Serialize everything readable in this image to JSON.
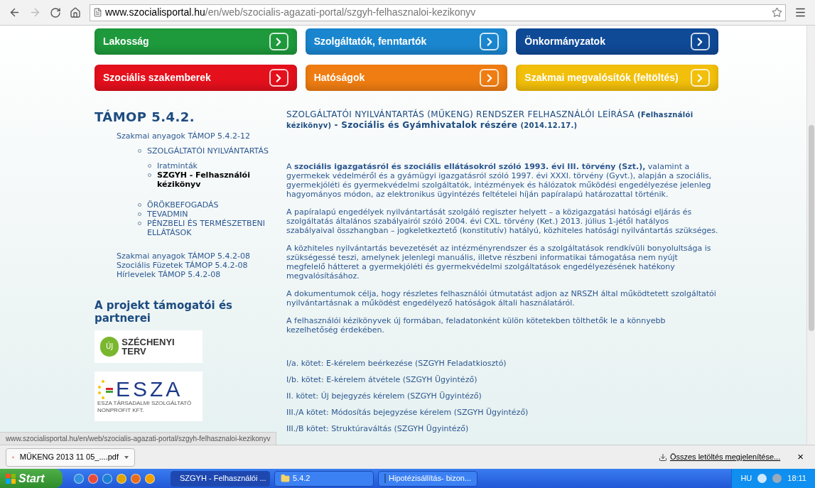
{
  "browser": {
    "url_host": "www.szocialisportal.hu",
    "url_path": "/en/web/szocialis-agazati-portal/szgyh-felhasznaloi-kezikonyv"
  },
  "categories": [
    {
      "label": "Lakosság",
      "color": "#1e9a3c"
    },
    {
      "label": "Szolgáltatók, fenntartók",
      "color": "#1a86cf"
    },
    {
      "label": "Önkormányzatok",
      "color": "#0f4a97"
    },
    {
      "label": "Szociális szakemberek",
      "color": "#e4101c"
    },
    {
      "label": "Hatóságok",
      "color": "#ef7d12"
    },
    {
      "label": "Szakmai megvalósítók (feltöltés)",
      "color": "#f2bf0a"
    }
  ],
  "sidebar": {
    "title": "TÁMOP 5.4.2.",
    "items": [
      {
        "label": "Szakmai anyagok TÁMOP 5.4.2-12",
        "selected": false,
        "children": [
          {
            "label": "SZOLGÁLTATÓI NYILVÁNTARTÁS",
            "selected": false,
            "children": [
              {
                "label": "Iratminták",
                "selected": false
              },
              {
                "label": "SZGYH - Felhasználói kézikönyv",
                "selected": true
              }
            ]
          },
          {
            "label": "ÖRÖKBEFOGADÁS",
            "selected": false
          },
          {
            "label": "TEVADMIN",
            "selected": false
          },
          {
            "label": "PÉNZBELI ÉS TERMÉSZETBENI ELLÁTÁSOK",
            "selected": false
          }
        ]
      },
      {
        "label": "Szakmai anyagok TÁMOP 5.4.2-08",
        "selected": false
      },
      {
        "label": "Szociális Füzetek TÁMOP 5.4.2-08",
        "selected": false
      },
      {
        "label": "Hírlevelek TÁMOP 5.4.2-08",
        "selected": false
      }
    ],
    "partners_title": "A projekt támogatói és partnerei",
    "partners": [
      {
        "kind": "szechenyi",
        "badge": "ÚJ",
        "name": "SZÉCHENYI TERV"
      },
      {
        "kind": "esza",
        "name": "ESZA",
        "subtitle": "ESZA TÁRSADALMI SZOLGÁLTATÓ NONPROFIT KFT."
      }
    ]
  },
  "article": {
    "title": "SZOLGÁLTATÓI NYILVÁNTARTÁS (MŰKENG) RENDSZER FELHASZNÁLÓI LEÍRÁSA",
    "title_small": "(Felhasználói kézikönyv)",
    "title_rest": "- Szociális és Gyámhivatalok részére",
    "date": "(2014.12.17.)",
    "paragraphs": [
      "A **szociális igazgatásról és szociális ellátásokról szóló 1993. évi III. törvény (Szt.),** valamint a gyermekek védelméről és a gyámügyi igazgatásról szóló 1997. évi XXXI. törvény (Gyvt.), alapján a szociális, gyermekjóléti és gyermekvédelmi szolgáltatók, intézmények és hálózatok működési engedélyezése jelenleg hagyományos módon, az elektronikus ügyintézés feltételei híján papíralapú határozattal történik.",
      "A papíralapú engedélyek nyilvántartását szolgáló regiszter helyett – a közigazgatási hatósági eljárás és szolgáltatás általános szabályairól szóló 2004. évi CXL. törvény (Ket.) 2013. július 1-jétől hatályos szabályaival összhangban – jogkeletkeztető (konstitutív) hatályú, közhiteles hatósági nyilvántartás szükséges.",
      "A közhiteles nyilvántartás bevezetését az intézményrendszer és a szolgáltatások rendkívüli bonyolultsága is szükségessé teszi, amelynek jelenlegi manuális, illetve részbeni informatikai támogatása nem nyújt megfelelő hátteret a gyermekjóléti és gyermekvédelmi szolgáltatások engedélyezésének hatékony megvalósításához.",
      "A dokumentumok célja, hogy részletes felhasználói útmutatást adjon az NRSZH által működtetett szolgáltatói nyilvántartásnak a működést engedélyező hatóságok általi használatáról.",
      "A felhasználói kézikönyvek új formában, feladatonként külön kötetekben tölthetők le a könnyebb kezelhetőség érdekében."
    ],
    "volumes": [
      "I/a. kötet: E-kérelem beérkezése (SZGYH Feladatkiosztó)",
      "I/b. kötet: E-kérelem átvétele (SZGYH Ügyintéző)",
      "II. kötet: Új bejegyzés kérelem (SZGYH Ügyintéző)",
      "III./A kötet: Módosítás bejegyzése kérelem (SZGYH Ügyintéző)",
      "III./B kötet: Struktúraváltás (SZGYH Ügyintéző)"
    ]
  },
  "status_url": "www.szocialisportal.hu/en/web/szocialis-agazati-portal/szgyh-felhasznaloi-kezikonyv",
  "downloads": {
    "file": "MŰKENG 2013 11 05_....pdf",
    "show_all": "Összes letöltés megjelenítése...",
    "close": "×"
  },
  "taskbar": {
    "start": "Start",
    "tasks": [
      {
        "kind": "chrome",
        "label": "SZGYH - Felhasználói ...",
        "selected": true
      },
      {
        "kind": "folder",
        "label": "5.4.2",
        "selected": false
      },
      {
        "kind": "word",
        "label": "Hipotézisállítás- bizon...",
        "selected": false
      }
    ],
    "lang": "HU",
    "time": "18:11"
  }
}
